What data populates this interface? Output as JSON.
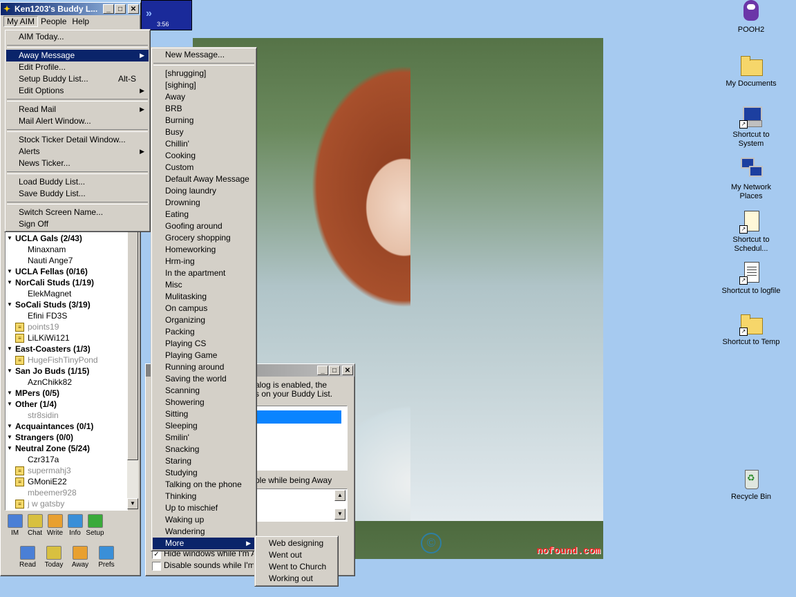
{
  "desktop": {
    "icons": [
      {
        "label": "POOH2",
        "icon": "pooh-bear-icon"
      },
      {
        "label": "My Documents",
        "icon": "folder-icon"
      },
      {
        "label": "Shortcut to System",
        "icon": "computer-icon"
      },
      {
        "label": "My Network Places",
        "icon": "network-icon"
      },
      {
        "label": "Shortcut to Schedul...",
        "icon": "scheduler-icon"
      },
      {
        "label": "Shortcut to logfile",
        "icon": "document-icon"
      },
      {
        "label": "Shortcut to Temp",
        "icon": "folder-icon"
      },
      {
        "label": "Recycle Bin",
        "icon": "recycle-bin-icon"
      }
    ]
  },
  "photo": {
    "watermark": "nofound.com",
    "copyright_symbol": "©"
  },
  "ticker": {
    "time": "3:56"
  },
  "buddy_window": {
    "title": "Ken1203's Buddy L...",
    "menubar": [
      "My AIM",
      "People",
      "Help"
    ],
    "list": [
      {
        "type": "group",
        "text": "UCLA Gals (2/43)"
      },
      {
        "type": "online",
        "text": "Minaxnam"
      },
      {
        "type": "online",
        "text": "Nauti  Ange7"
      },
      {
        "type": "group",
        "text": "UCLA Fellas (0/16)"
      },
      {
        "type": "group",
        "text": "NorCali Studs (1/19)"
      },
      {
        "type": "online",
        "text": "ElekMagnet"
      },
      {
        "type": "group",
        "text": "SoCali Studs (3/19)"
      },
      {
        "type": "online",
        "text": "Efini FD3S"
      },
      {
        "type": "idle",
        "text": "points19",
        "note": true
      },
      {
        "type": "online",
        "text": "LiLKiWi121",
        "note": true
      },
      {
        "type": "group",
        "text": "East-Coasters (1/3)"
      },
      {
        "type": "idle",
        "text": "HugeFishTinyPond",
        "note": true
      },
      {
        "type": "group",
        "text": "San Jo Buds (1/15)"
      },
      {
        "type": "online",
        "text": "AznChikk82"
      },
      {
        "type": "group",
        "text": "MPers (0/5)"
      },
      {
        "type": "group",
        "text": "Other (1/4)"
      },
      {
        "type": "idle",
        "text": "str8sidin"
      },
      {
        "type": "group",
        "text": "Acquaintances (0/1)"
      },
      {
        "type": "group",
        "text": "Strangers (0/0)"
      },
      {
        "type": "group",
        "text": "Neutral Zone (5/24)"
      },
      {
        "type": "online",
        "text": "Czr317a"
      },
      {
        "type": "idle",
        "text": "supermahj3",
        "note": true
      },
      {
        "type": "online",
        "text": "GMoniE22",
        "note": true
      },
      {
        "type": "idle",
        "text": "mbeemer928"
      },
      {
        "type": "idle",
        "text": "j w gatsby",
        "note": true
      }
    ],
    "toolbar1": [
      {
        "label": "IM",
        "icon": "im-icon"
      },
      {
        "label": "Chat",
        "icon": "chat-icon"
      },
      {
        "label": "Write",
        "icon": "write-icon"
      },
      {
        "label": "Info",
        "icon": "info-icon"
      },
      {
        "label": "Setup",
        "icon": "setup-icon"
      }
    ],
    "toolbar2": [
      {
        "label": "Read",
        "icon": "mailbox-icon"
      },
      {
        "label": "Today",
        "icon": "today-icon"
      },
      {
        "label": "Away",
        "icon": "away-icon"
      },
      {
        "label": "Prefs",
        "icon": "prefs-icon"
      }
    ]
  },
  "my_aim_menu": [
    {
      "label": "AIM Today..."
    },
    {
      "sep": true
    },
    {
      "label": "Away Message",
      "submenu": true,
      "highlight": true
    },
    {
      "label": "Edit Profile..."
    },
    {
      "label": "Setup Buddy List...",
      "accel": "Alt-S"
    },
    {
      "label": "Edit Options",
      "submenu": true
    },
    {
      "sep": true
    },
    {
      "label": "Read Mail",
      "submenu": true
    },
    {
      "label": "Mail Alert Window..."
    },
    {
      "sep": true
    },
    {
      "label": "Stock Ticker Detail Window..."
    },
    {
      "label": "Alerts",
      "submenu": true
    },
    {
      "label": "News Ticker..."
    },
    {
      "sep": true
    },
    {
      "label": "Load Buddy List..."
    },
    {
      "label": "Save Buddy List..."
    },
    {
      "sep": true
    },
    {
      "label": "Switch Screen Name..."
    },
    {
      "label": "Sign Off"
    }
  ],
  "away_menu": [
    {
      "label": "New Message..."
    },
    {
      "sep": true
    },
    {
      "label": "[shrugging]"
    },
    {
      "label": "[sighing]"
    },
    {
      "label": "Away"
    },
    {
      "label": "BRB"
    },
    {
      "label": "Burning"
    },
    {
      "label": "Busy"
    },
    {
      "label": "Chillin'"
    },
    {
      "label": "Cooking"
    },
    {
      "label": "Custom"
    },
    {
      "label": "Default Away Message"
    },
    {
      "label": "Doing laundry"
    },
    {
      "label": "Drowning"
    },
    {
      "label": "Eating"
    },
    {
      "label": "Goofing around"
    },
    {
      "label": "Grocery shopping"
    },
    {
      "label": "Homeworking"
    },
    {
      "label": "Hrm-ing"
    },
    {
      "label": "In the apartment"
    },
    {
      "label": "Misc"
    },
    {
      "label": "Mulitasking"
    },
    {
      "label": "On campus"
    },
    {
      "label": "Organizing"
    },
    {
      "label": "Packing"
    },
    {
      "label": "Playing CS"
    },
    {
      "label": "Playing Game"
    },
    {
      "label": "Running around"
    },
    {
      "label": "Saving the world"
    },
    {
      "label": "Scanning"
    },
    {
      "label": "Showering"
    },
    {
      "label": "Sitting"
    },
    {
      "label": "Sleeping"
    },
    {
      "label": "Smilin'"
    },
    {
      "label": "Snacking"
    },
    {
      "label": "Staring"
    },
    {
      "label": "Studying"
    },
    {
      "label": "Talking on the phone"
    },
    {
      "label": "Thinking"
    },
    {
      "label": "Up to mischief"
    },
    {
      "label": "Waking up"
    },
    {
      "label": "Wandering"
    },
    {
      "label": "More",
      "submenu": true,
      "highlight": true
    }
  ],
  "more_menu": [
    {
      "label": "Web designing"
    },
    {
      "label": "Went out"
    },
    {
      "label": "Went to Church"
    },
    {
      "label": "Working out"
    }
  ],
  "away_dialog": {
    "text_line1": "alog is enabled, the",
    "text_line2": "s on your Buddy List.",
    "checkbox_text": "ple while being Away",
    "hide_windows": "Hide windows while I'm Away",
    "disable_sounds": "Disable sounds while I'm Away",
    "hide_checked": true,
    "disable_checked": false
  },
  "colors": {
    "desktop": "#a6caf0",
    "menu_highlight": "#0a246a",
    "title_active": "#0a246a",
    "list_selection": "#0a84ff",
    "watermark": "#ff2222"
  }
}
